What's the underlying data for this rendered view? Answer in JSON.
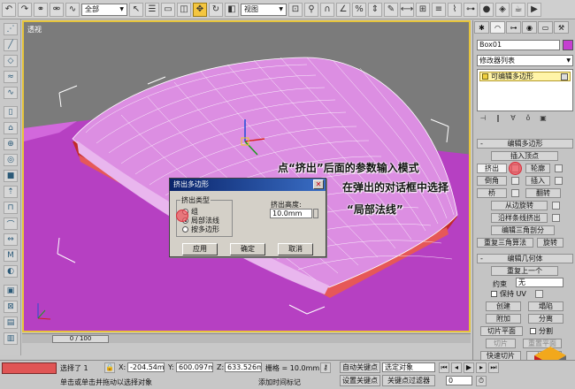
{
  "toolbar": {
    "selection_filter": "全部",
    "ref_coord": "视图"
  },
  "viewport": {
    "label": "透视"
  },
  "timeline": {
    "slider_text": "0 / 100"
  },
  "command_panel": {
    "object_name": "Box01",
    "modifier_list": "修改器列表",
    "stack_item": "可编辑多边形",
    "rollout_edit_poly": "编辑多边形",
    "insert_vertex": "插入顶点",
    "extrude": "挤出",
    "outline": "轮廓",
    "bevel": "倒角",
    "inset": "插入",
    "bridge": "桥",
    "flip": "翻转",
    "hinge_from_edge": "从边旋转",
    "extrude_along_spline": "沿样条线挤出",
    "edit_triangulation": "编辑三角剖分",
    "retriangulate": "重复三角算法",
    "turn": "旋转",
    "rollout_edit_geometry": "编辑几何体",
    "repeat_last": "重复上一个",
    "constraints_label": "约束",
    "constraints_value": "无",
    "preserve_uv": "保持 UV",
    "create": "创建",
    "collapse": "塌陷",
    "attach": "附加",
    "detach": "分离",
    "slice_plane": "切片平面",
    "split": "分割",
    "slice": "切片",
    "reset_plane": "重置平面",
    "quickslice": "快速切片",
    "cut": "切割"
  },
  "dialog": {
    "title": "挤出多边形",
    "group_label": "挤出类型",
    "option_group": "组",
    "option_local_normal": "局部法线",
    "option_by_polygon": "按多边形",
    "height_label": "挤出高度:",
    "height_value": "10.0mm",
    "apply": "应用",
    "ok": "确定",
    "cancel": "取消"
  },
  "annotation": {
    "line1": "点“挤出”后面的参数输入模式",
    "line2": "在弹出的对话框中选择",
    "line3": "“局部法线”"
  },
  "statusbar": {
    "selected": "选择了 1",
    "x_label": "X:",
    "x_value": "-204.54mm",
    "y_label": "Y:",
    "y_value": "600.097mm",
    "z_label": "Z:",
    "z_value": "633.526mm",
    "grid": "栅格 = 10.0mm",
    "auto_key": "自动关键点",
    "selected_objects": "选定对象",
    "set_key": "设置关键点",
    "key_filters": "关键点过滤器",
    "frame": "0",
    "prompt": "单击或单击并拖动以选择对象",
    "add_time_tag": "添加时间标记"
  }
}
